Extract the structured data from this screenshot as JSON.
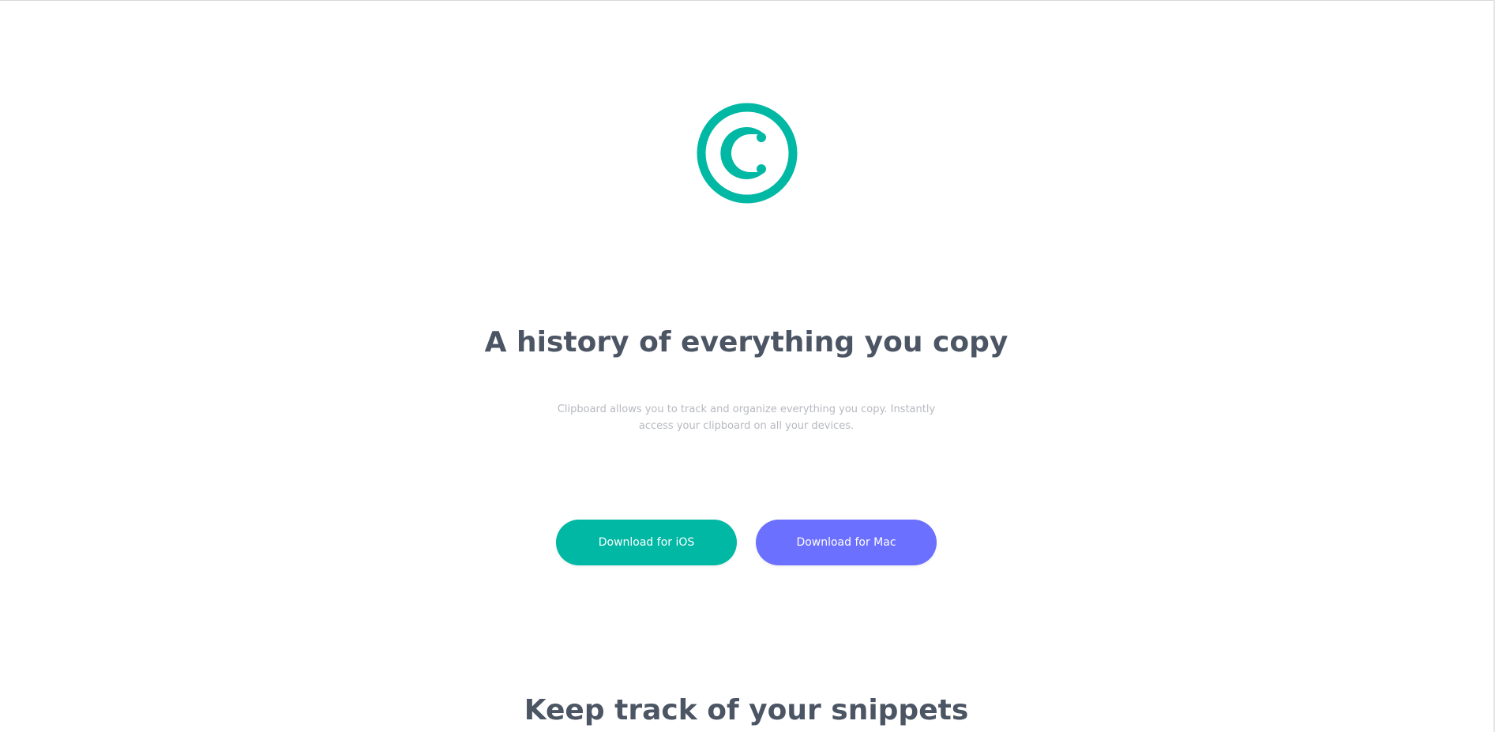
{
  "logo": {
    "icon": "copyright-circle-icon",
    "color": "#00b8a4"
  },
  "hero": {
    "title": "A history of everything you copy",
    "description": "Clipboard allows you to track and organize everything you copy. Instantly access your clipboard on all your devices."
  },
  "buttons": {
    "ios_label": "Download for iOS",
    "mac_label": "Download for Mac",
    "ios_color": "#00b8a4",
    "mac_color": "#6b70ff"
  },
  "snippets": {
    "title": "Keep track of your snippets"
  }
}
